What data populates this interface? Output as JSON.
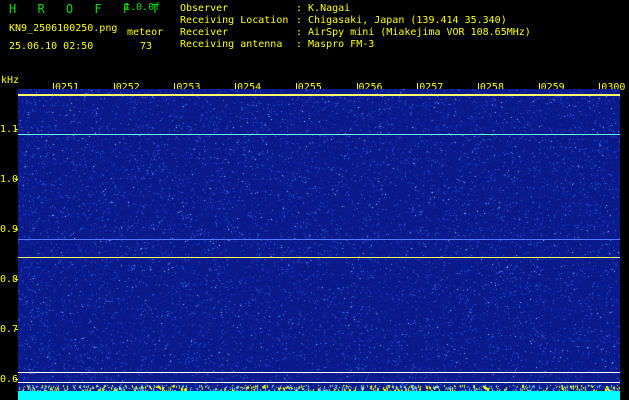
{
  "header": {
    "title": "H R O F F T",
    "version": "1.0.0f",
    "filename": "KN9_2506100250.png",
    "meteor_label": "meteor",
    "datetime": "25.06.10 02:50",
    "meteor_count": "73"
  },
  "info": [
    {
      "key": "Observer",
      "value": ": K.Nagai"
    },
    {
      "key": "Receiving Location",
      "value": ": Chigasaki, Japan (139.414 35.340)"
    },
    {
      "key": "Receiver",
      "value": ": AirSpy mini (Miakejima VOR 108.65MHz)"
    },
    {
      "key": "Receiving antenna",
      "value": ": Maspro FM-3"
    }
  ],
  "chart_data": {
    "type": "heatmap",
    "ylabel": "kHz",
    "y_ticks": [
      "1.1",
      "1.0",
      "0.9",
      "0.8",
      "0.7",
      "0.6"
    ],
    "x_ticks": [
      "0251",
      "0252",
      "0253",
      "0254",
      "0255",
      "0256",
      "0257",
      "0258",
      "0259",
      "0300"
    ],
    "background_color": "#0a1a8a",
    "trace_lines": [
      {
        "freq_khz": 1.17,
        "color": "#ffff66"
      },
      {
        "freq_khz": 1.09,
        "color": "#66ffee"
      },
      {
        "freq_khz": 0.88,
        "color": "#5577ff"
      },
      {
        "freq_khz": 0.845,
        "color": "#eeff66"
      },
      {
        "freq_khz": 0.615,
        "color": "#ffffff"
      },
      {
        "freq_khz": 0.595,
        "color": "#ffffff"
      }
    ]
  }
}
